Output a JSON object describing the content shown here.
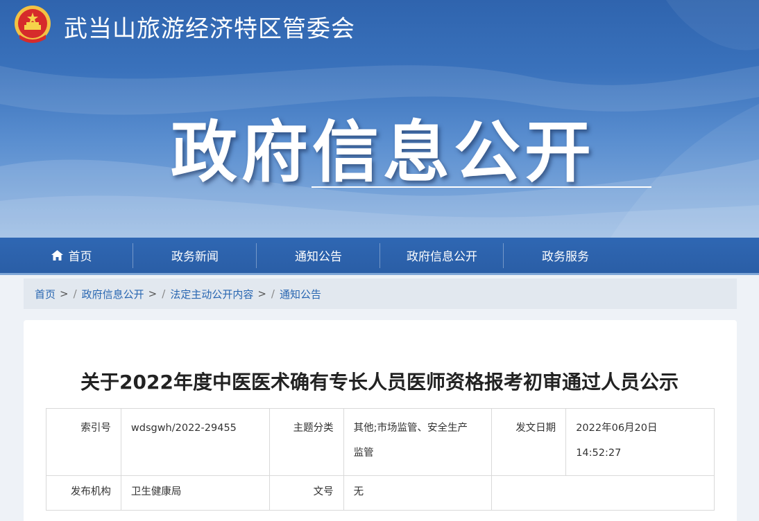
{
  "header": {
    "site_title": "武当山旅游经济特区管委会",
    "banner_title": "政府信息公开",
    "colors": {
      "banner": "#2f64ae",
      "nav": "#2a5ea6",
      "link": "#2866b1"
    }
  },
  "nav": {
    "items": [
      {
        "label": "首页",
        "icon": "home-icon"
      },
      {
        "label": "政务新闻"
      },
      {
        "label": "通知公告"
      },
      {
        "label": "政府信息公开"
      },
      {
        "label": "政务服务"
      }
    ]
  },
  "breadcrumb": {
    "items": [
      "首页",
      "政府信息公开",
      "法定主动公开内容",
      "通知公告"
    ],
    "separator": ">"
  },
  "article": {
    "title": "关于2022年度中医医术确有专长人员医师资格报考初审通过人员公示",
    "meta": {
      "index_label": "索引号",
      "index_value": "wdsgwh/2022-29455",
      "topic_label": "主题分类",
      "topic_value_line1": "其他;市场监管、安全生产",
      "topic_value_line2": "监管",
      "date_label": "发文日期",
      "date_value_line1": "2022年06月20日",
      "date_value_line2": "14:52:27",
      "org_label": "发布机构",
      "org_value": "卫生健康局",
      "docno_label": "文号",
      "docno_value": "无"
    }
  }
}
